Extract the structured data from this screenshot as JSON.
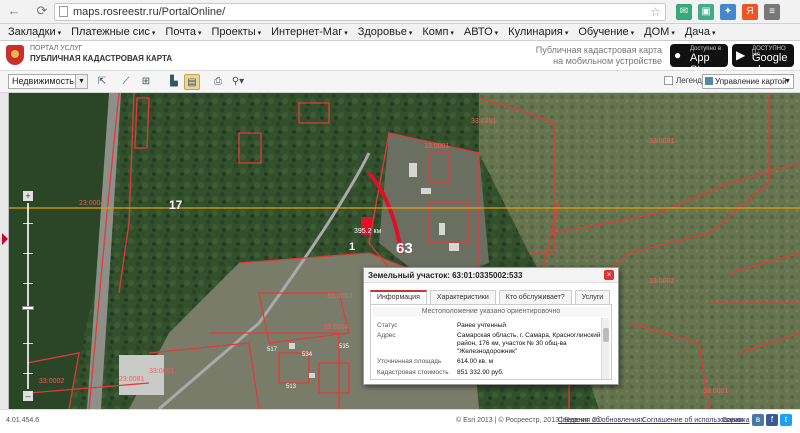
{
  "browser": {
    "url": "maps.rosreestr.ru/PortalOnline/"
  },
  "bookmarks": [
    {
      "label": "Закладки",
      "caret": "▾"
    },
    {
      "label": "Платежные сис",
      "caret": "▾"
    },
    {
      "label": "Почта",
      "caret": "▾"
    },
    {
      "label": "Проекты",
      "caret": "▾"
    },
    {
      "label": "Интернет-Маг",
      "caret": "▾"
    },
    {
      "label": "Здоровье",
      "caret": "▾"
    },
    {
      "label": "Комп",
      "caret": "▾"
    },
    {
      "label": "АВТО",
      "caret": "▾"
    },
    {
      "label": "Кулинария",
      "caret": "▾"
    },
    {
      "label": "Обучение",
      "caret": "▾"
    },
    {
      "label": "ДОМ",
      "caret": "▾"
    },
    {
      "label": "Дача",
      "caret": "▾"
    }
  ],
  "header": {
    "small": "ПОРТАЛ УСЛУГ",
    "title": "ПУБЛИЧНАЯ КАДАСТРОВАЯ КАРТА",
    "mobile_line1": "Публичная кадастровая карта",
    "mobile_line2": "на мобильном устройстве",
    "appstore_small": "Доступно в",
    "appstore_big": "App Store",
    "googleplay_small": "ДОСТУПНО НА",
    "googleplay_big": "Google play"
  },
  "toolbar": {
    "layer_select": "Недвижимость",
    "legend_label": "Легенда",
    "map_mode": "Управление картой"
  },
  "map": {
    "labels": [
      {
        "text": "17",
        "size": 12,
        "color": "#ffffff"
      },
      {
        "text": "63",
        "size": 15,
        "color": "#ffffff"
      },
      {
        "text": "1",
        "size": 11,
        "color": "#ffffff"
      },
      {
        "text": "395.2 км",
        "size": 7,
        "color": "#ffffff"
      },
      {
        "text": "33:0201",
        "size": 7,
        "color": "#ff5a5a"
      },
      {
        "text": "33:0091",
        "size": 7,
        "color": "#ff5a5a"
      },
      {
        "text": "23:0004",
        "size": 7,
        "color": "#ff5a5a"
      },
      {
        "text": "33:0001",
        "size": 7,
        "color": "#ff5a5a"
      },
      {
        "text": "33:0002",
        "size": 7,
        "color": "#ff5a5a"
      },
      {
        "text": "33:0003",
        "size": 7,
        "color": "#ff5a5a"
      },
      {
        "text": "33:0004",
        "size": 7,
        "color": "#ff5a5a"
      },
      {
        "text": "33:0001",
        "size": 7,
        "color": "#ff5a5a"
      },
      {
        "text": "33:0002",
        "size": 7,
        "color": "#ff5a5a"
      },
      {
        "text": "23:0081",
        "size": 7,
        "color": "#ff5a5a"
      },
      {
        "text": "33:0001",
        "size": 7,
        "color": "#ff5a5a"
      },
      {
        "text": "517",
        "size": 6,
        "color": "#ffffff"
      },
      {
        "text": "534",
        "size": 6,
        "color": "#ffffff"
      },
      {
        "text": "513",
        "size": 6,
        "color": "#ffffff"
      },
      {
        "text": "535",
        "size": 6,
        "color": "#ffffff"
      }
    ]
  },
  "popup": {
    "title": "Земельный участок: 63:01:0335002:533",
    "close": "×",
    "tabs": [
      "Информация",
      "Характеристики",
      "Кто обслуживает?",
      "Услуги"
    ],
    "notice": "Местоположение указано ориентировочно",
    "rows": [
      {
        "key": "Статус",
        "value": "Ранее учтенный"
      },
      {
        "key": "Адрес",
        "value": "Самарская область, г. Самара, Красноглинский район, 176 км, участок № 30 общ-ва \"Железнодорожник\""
      },
      {
        "key": "Уточненная площадь",
        "value": "614.00 кв. м"
      },
      {
        "key": "Кадастровая стоимость",
        "value": "851 332.90 руб."
      }
    ]
  },
  "footer": {
    "version": "4.01.454.6",
    "copyright": "© Esri 2013 | © Росреестр, 2013 | Версия: 2.0",
    "link1": "Сведения об обновлениях",
    "link2": "Соглашение об использовании",
    "link3": "Справка"
  }
}
